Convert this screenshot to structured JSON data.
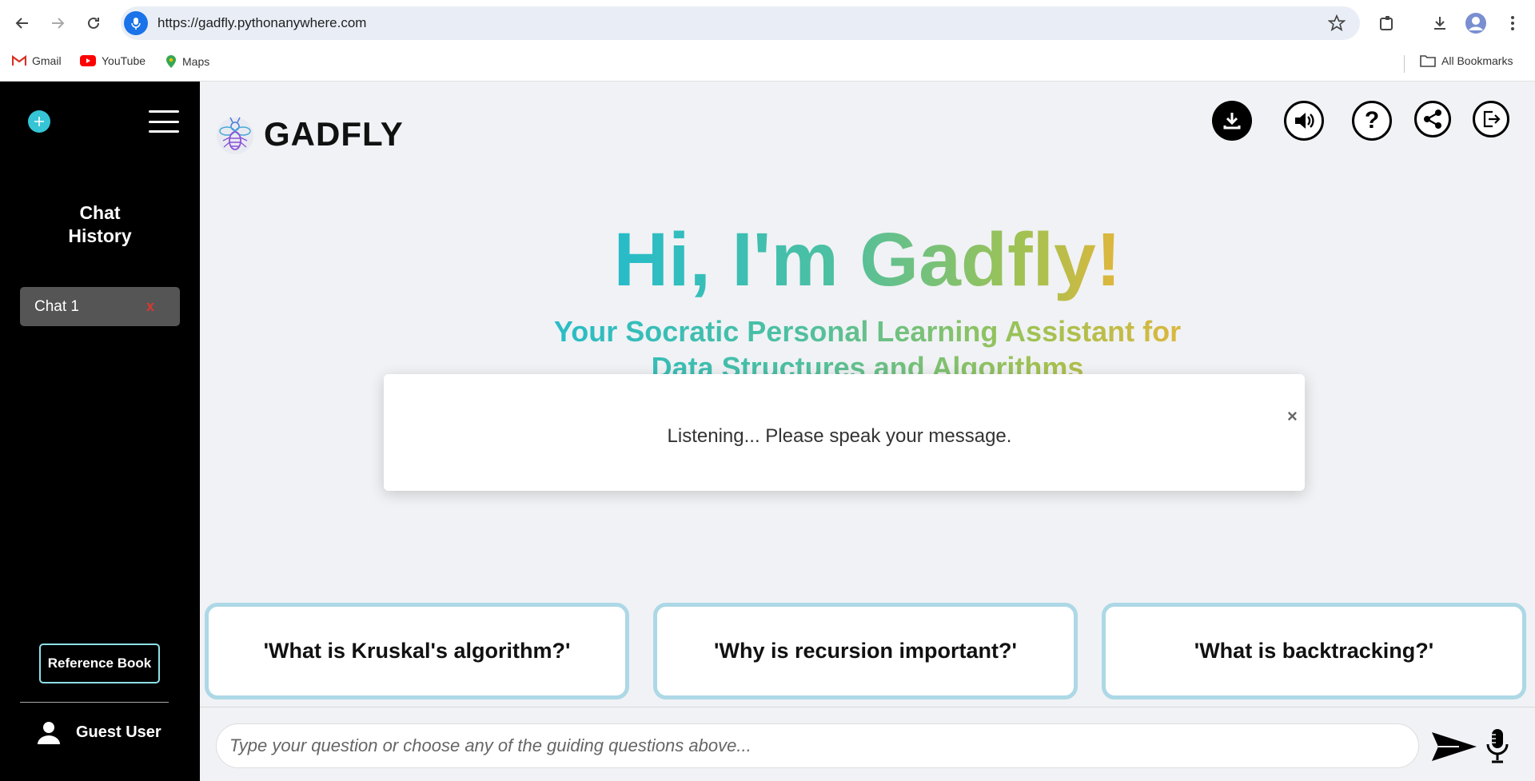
{
  "browser": {
    "url": "https://gadfly.pythonanywhere.com",
    "bookmarks": [
      "Gmail",
      "YouTube",
      "Maps"
    ],
    "all_bookmarks": "All Bookmarks"
  },
  "sidebar": {
    "history_title_line1": "Chat",
    "history_title_line2": "History",
    "chats": [
      {
        "label": "Chat 1",
        "delete": "x"
      }
    ],
    "reference_book": "Reference Book",
    "user": "Guest User"
  },
  "main": {
    "logo_text": "GADFLY",
    "hero_title": "Hi, I'm Gadfly!",
    "hero_subtitle": "Your Socratic Personal Learning Assistant for Data Structures and Algorithms",
    "modal": {
      "message": "Listening... Please speak your message.",
      "close": "×"
    },
    "suggestions": [
      "'What is Kruskal's algorithm?'",
      "'Why is recursion important?'",
      "'What is backtracking?'"
    ],
    "input_placeholder": "Type your question or choose any of the guiding questions above..."
  },
  "colors": {
    "accent_cyan": "#27bcc9",
    "accent_green": "#9fc253",
    "accent_gold": "#e1b63c",
    "suggestion_border": "#add8e6",
    "sidebar_bg": "#000000"
  }
}
